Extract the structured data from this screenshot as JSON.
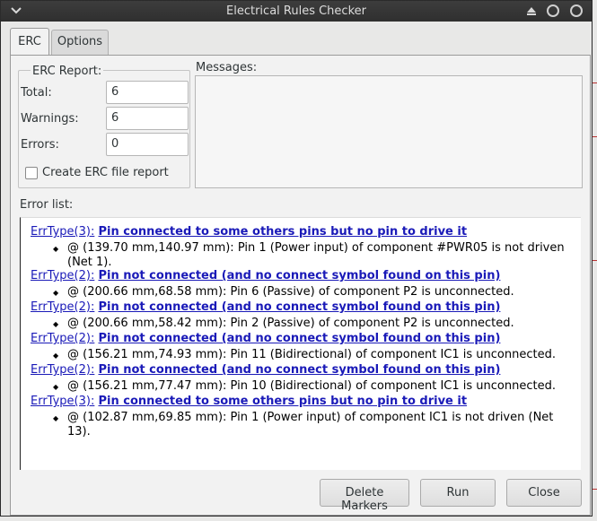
{
  "window": {
    "title": "Electrical Rules Checker"
  },
  "tabs": {
    "erc": "ERC",
    "options": "Options"
  },
  "report": {
    "group_label": "ERC Report:",
    "total_label": "Total:",
    "total_value": "6",
    "warnings_label": "Warnings:",
    "warnings_value": "6",
    "errors_label": "Errors:",
    "errors_value": "0",
    "create_file_label": "Create ERC file report",
    "create_file_checked": false
  },
  "messages": {
    "label": "Messages:",
    "content": ""
  },
  "error_list": {
    "label": "Error list:",
    "items": [
      {
        "type": "ErrType(3):",
        "title": "Pin connected to some others pins but no pin to drive it",
        "detail": "@ (139.70 mm,140.97 mm): Pin 1 (Power input) of component #PWR05 is not driven (Net 1)."
      },
      {
        "type": "ErrType(2):",
        "title": "Pin not connected (and no connect symbol found on this pin)",
        "detail": "@ (200.66 mm,68.58 mm): Pin 6 (Passive) of component P2 is unconnected."
      },
      {
        "type": "ErrType(2):",
        "title": "Pin not connected (and no connect symbol found on this pin)",
        "detail": "@ (200.66 mm,58.42 mm): Pin 2 (Passive) of component P2 is unconnected."
      },
      {
        "type": "ErrType(2):",
        "title": "Pin not connected (and no connect symbol found on this pin)",
        "detail": "@ (156.21 mm,74.93 mm): Pin 11 (Bidirectional) of component IC1 is unconnected."
      },
      {
        "type": "ErrType(2):",
        "title": "Pin not connected (and no connect symbol found on this pin)",
        "detail": "@ (156.21 mm,77.47 mm): Pin 10 (Bidirectional) of component IC1 is unconnected."
      },
      {
        "type": "ErrType(3):",
        "title": "Pin connected to some others pins but no pin to drive it",
        "detail": "@ (102.87 mm,69.85 mm): Pin 1 (Power input) of component IC1 is not driven (Net 13)."
      }
    ]
  },
  "buttons": {
    "delete_markers": "Delete Markers",
    "run": "Run",
    "close": "Close"
  },
  "icons": {
    "window_menu": "chevron-down-icon",
    "shade": "shade-triangle-icon",
    "minimize": "circle-icon",
    "maximize": "circle-icon",
    "bullet": "diamond-bullet-icon"
  },
  "colors": {
    "link": "#1a1ab8",
    "titlebar": "#333333",
    "panel": "#f2f2f2"
  }
}
